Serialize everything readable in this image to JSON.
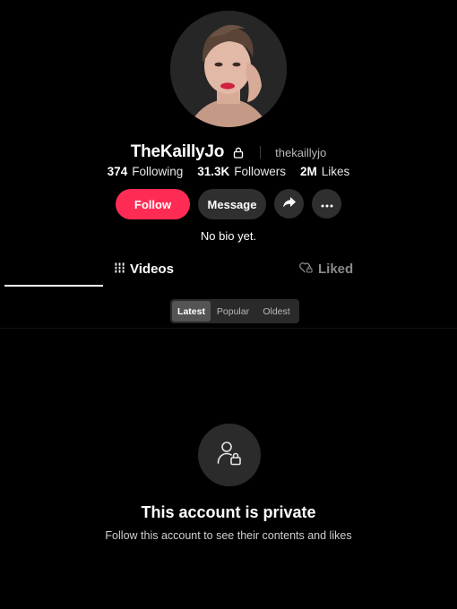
{
  "profile": {
    "display_name": "TheKaillyJo",
    "username": "thekaillyjo",
    "bio": "No bio yet.",
    "avatar_alt": "profile photo"
  },
  "stats": {
    "following_count": "374",
    "following_label": "Following",
    "followers_count": "31.3K",
    "followers_label": "Followers",
    "likes_count": "2M",
    "likes_label": "Likes"
  },
  "actions": {
    "follow_label": "Follow",
    "message_label": "Message",
    "share_icon": "share-arrow-icon",
    "more_icon": "more-dots-icon"
  },
  "tabs": [
    {
      "label": "Videos",
      "icon": "grid-icon",
      "active": true
    },
    {
      "label": "Liked",
      "icon": "heart-lock-icon",
      "active": false
    }
  ],
  "sort": {
    "options": [
      "Latest",
      "Popular",
      "Oldest"
    ],
    "selected": "Latest"
  },
  "private": {
    "title": "This account is private",
    "subtitle": "Follow this account to see their contents and likes",
    "icon": "user-lock-icon"
  },
  "colors": {
    "background": "#000000",
    "accent": "#fe2c55",
    "button_dark": "#2f2f2f",
    "muted_text": "#8a8a8a"
  }
}
